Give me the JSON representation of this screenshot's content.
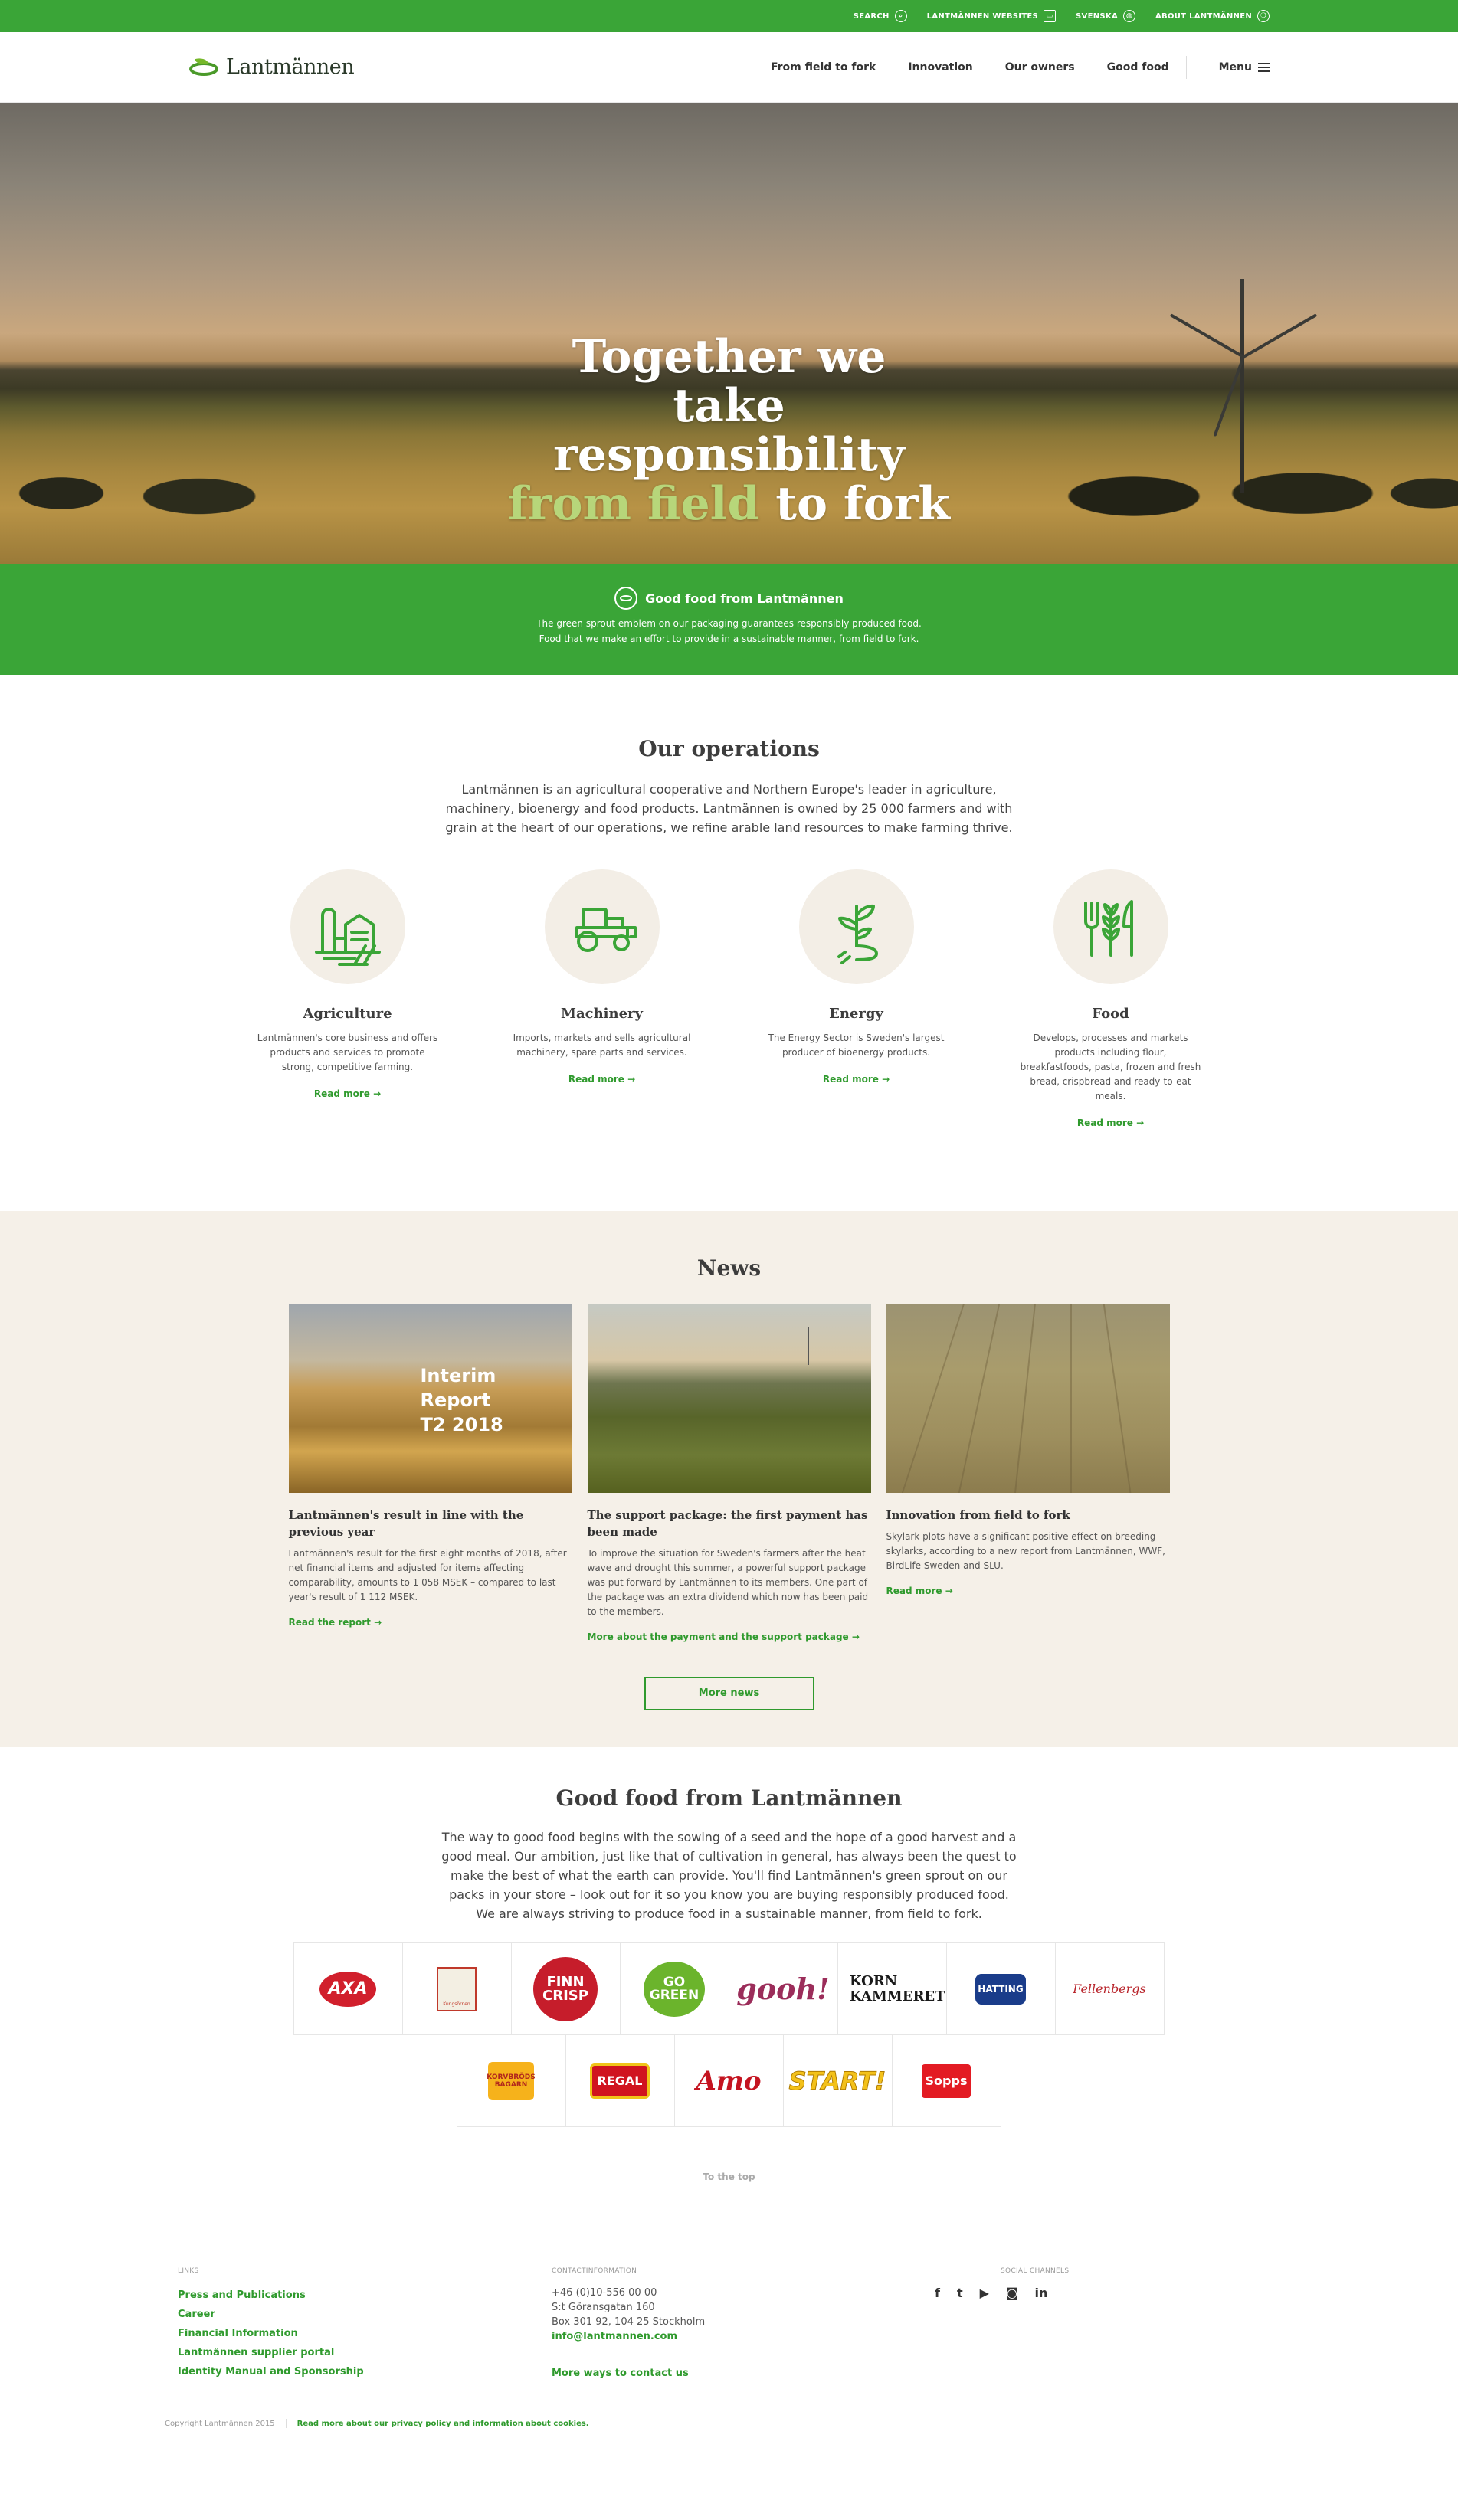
{
  "topbar": {
    "search": "SEARCH",
    "websites": "LANTMÄNNEN WEBSITES",
    "language": "SVENSKA",
    "about": "ABOUT LANTMÄNNEN"
  },
  "header": {
    "logo_text": "Lantmännen",
    "nav": [
      "From field to fork",
      "Innovation",
      "Our owners",
      "Good food"
    ],
    "menu_label": "Menu"
  },
  "hero": {
    "line1": "Together we",
    "line2": "take",
    "line3": "responsibility",
    "highlight": "from field",
    "line4_rest": " to fork"
  },
  "band": {
    "title": "Good food from Lantmännen",
    "text1": "The green sprout emblem on our packaging guarantees responsibly produced food.",
    "text2": "Food that we make an effort to provide in a sustainable manner, from field to fork."
  },
  "operations": {
    "title": "Our operations",
    "lead": "Lantmännen is an agricultural cooperative and Northern Europe's leader in agriculture, machinery, bioenergy and food products. Lantmännen is owned by 25 000 farmers and with grain at the heart of our operations, we refine arable land resources to make farming thrive.",
    "items": [
      {
        "icon": "farm-icon",
        "title": "Agriculture",
        "text": "Lantmännen's core business and offers products and services to promote strong, competitive farming.",
        "link": "Read more"
      },
      {
        "icon": "tractor-icon",
        "title": "Machinery",
        "text": "Imports, markets and sells agricultural machinery, spare parts and services.",
        "link": "Read more"
      },
      {
        "icon": "energy-sprout-icon",
        "title": "Energy",
        "text": "The Energy Sector is Sweden's largest producer of bioenergy products.",
        "link": "Read more"
      },
      {
        "icon": "food-cutlery-icon",
        "title": "Food",
        "text": "Develops, processes and markets products including flour, breakfastfoods, pasta, frozen and fresh bread, crispbread and ready-to-eat meals.",
        "link": "Read more"
      }
    ]
  },
  "news": {
    "title": "News",
    "items": [
      {
        "overlay": "Interim Report\nT2 2018",
        "title": "Lantmännen's result in line with the previous year",
        "text": "Lantmännen's result for the first eight months of 2018, after net financial items and adjusted for items affecting comparability, amounts to 1 058 MSEK – compared to last year's result of 1 112 MSEK.",
        "link": "Read the report"
      },
      {
        "overlay": "",
        "title": "The support package: the first payment has been made",
        "text": "To improve the situation for Sweden's farmers after the heat wave and drought this summer, a powerful support package was put forward by Lantmännen to its members. One part of the package was an extra dividend which now has been paid to the members.",
        "link": "More about the payment and the support package"
      },
      {
        "overlay": "",
        "title": "Innovation from field to fork",
        "text": "Skylark plots have a significant positive effect on breeding skylarks, according to a new report from Lantmännen, WWF, BirdLife Sweden and SLU.",
        "link": "Read more"
      }
    ],
    "more": "More news"
  },
  "goodfood": {
    "title": "Good food from Lantmännen",
    "lead": "The way to good food begins with the sowing of a seed and the hope of a good harvest and a good meal. Our ambition, just like that of cultivation in general, has always been the quest to make the best of what the earth can provide. You'll find Lantmännen's green sprout on our packs in your store – look out for it so you know you are buying responsibly produced food. We are always striving to produce food in a sustainable manner, from field to fork.",
    "brands": [
      "AXA",
      "Kungsörnen",
      "FINN CRISP",
      "GO GREEN",
      "gooh!",
      "KORN KAMMERET",
      "HATTING",
      "Fellenbergs",
      "KORVBRÖDS BAGARN",
      "REGAL",
      "Amo",
      "START!",
      "Sopps"
    ],
    "to_top": "To the top"
  },
  "footer": {
    "links_label": "LINKS",
    "links": [
      "Press and Publications",
      "Career",
      "Financial Information",
      "Lantmännen supplier portal",
      "Identity Manual and Sponsorship"
    ],
    "contact_label": "CONTACTINFORMATION",
    "phone": "+46 (0)10-556 00 00",
    "address1": "S:t Göransgatan 160",
    "address2": "Box 301 92, 104 25 Stockholm",
    "email": "info@lantmannen.com",
    "more_contact": "More ways to contact us",
    "social_label": "SOCIAL CHANNELS",
    "social": [
      "facebook-icon",
      "twitter-icon",
      "youtube-icon",
      "instagram-icon",
      "linkedin-icon"
    ],
    "copyright": "Copyright Lantmännen 2015",
    "privacy": "Read more about our privacy policy and information about cookies."
  },
  "colors": {
    "brand_green": "#3aa537",
    "link_green": "#2f9a2d",
    "beige": "#f5f0e8"
  }
}
